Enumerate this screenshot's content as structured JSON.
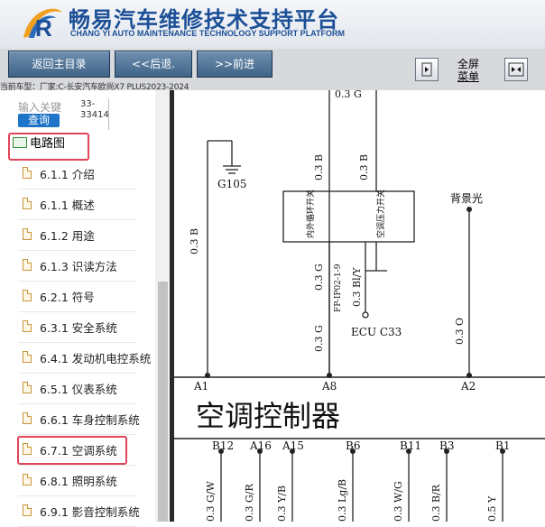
{
  "header": {
    "title_cn": "畅易汽车维修技术支持平台",
    "title_en": "CHANG YI AUTO MAINTENANCE TECHNOLOGY SUPPORT PLATFORM",
    "logo_letter": "R"
  },
  "toolbar": {
    "home_label": "返回主目录",
    "back_label": "<<后退.",
    "forward_label": ">>前进",
    "fullscreen_line1": "全屏",
    "fullscreen_line2": "菜单"
  },
  "vehicle": {
    "text": "当前车型：厂家:C-长安汽车欧尚X7 PLUS2023-2024"
  },
  "sidebar": {
    "search_placeholder": "输入关键",
    "search_button": "查询",
    "search_result_line1": "33-",
    "search_result_line2": "33414",
    "folder_label": "电路图",
    "items": [
      {
        "label": "6.1.1 介绍"
      },
      {
        "label": "6.1.1 概述"
      },
      {
        "label": "6.1.2 用途"
      },
      {
        "label": "6.1.3 识读方法"
      },
      {
        "label": "6.2.1 符号"
      },
      {
        "label": "6.3.1 安全系统"
      },
      {
        "label": "6.4.1 发动机电控系统"
      },
      {
        "label": "6.5.1 仪表系统"
      },
      {
        "label": "6.6.1 车身控制系统"
      },
      {
        "label": "6.7.1 空调系统"
      },
      {
        "label": "6.8.1 照明系统"
      },
      {
        "label": "6.9.1 影音控制系统"
      }
    ]
  },
  "diagram": {
    "top_label": "0.3 G",
    "ground_label": "G105",
    "wire_left": "0.3 B",
    "wire_mid1": "0.3 B",
    "wire_mid2": "0.3 B",
    "switch_left": "内外循环开关",
    "switch_right": "空调压力开关",
    "wire_g": "0.3 G",
    "wire_fp": "FP-IP02-1-9",
    "wire_bly": "0.3 Bl/Y",
    "backlight_label": "背景光",
    "ecu_label": "ECU C33",
    "wire_g2": "0.3 G",
    "wire_o": "0.3 O",
    "pin_a1": "A1",
    "pin_a8": "A8",
    "pin_a2": "A2",
    "module_title": "空调控制器",
    "pins_bottom": [
      "B12",
      "A16",
      "A15",
      "B6",
      "B11",
      "B3",
      "B1"
    ],
    "wires_bottom": [
      "0.3 G/W",
      "0.3 G/R",
      "0.3 Y/B",
      "0.3 Lg/B",
      "0.3 W/G",
      "0.3 B/R",
      "0.5 Y"
    ]
  }
}
